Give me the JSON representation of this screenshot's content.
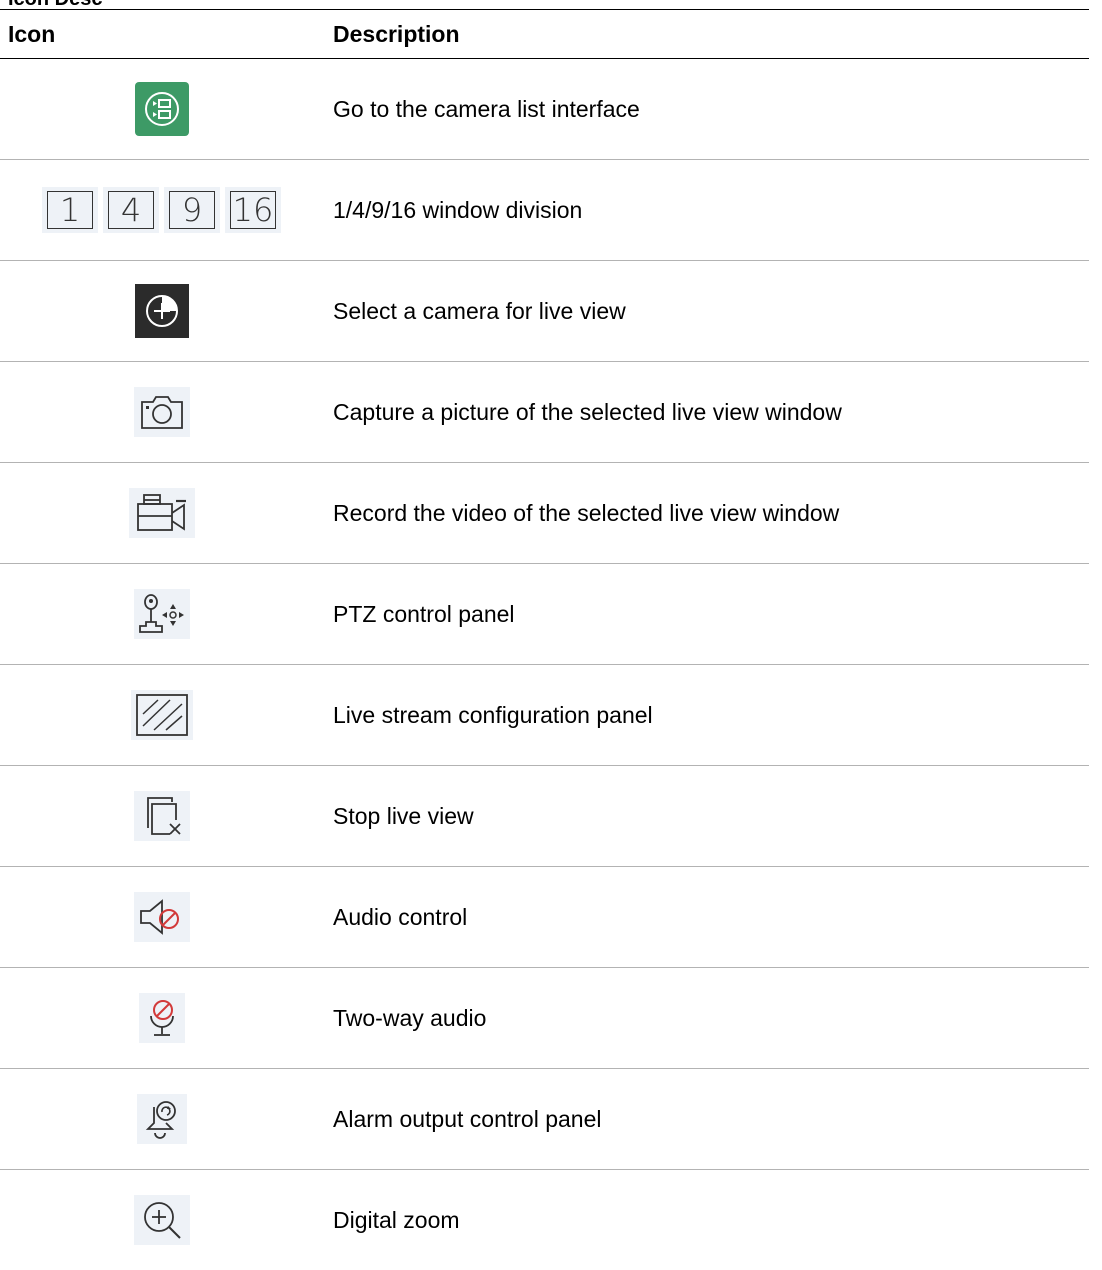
{
  "top_fragment": "Icon Desc",
  "headers": {
    "icon": "Icon",
    "description": "Description"
  },
  "division_labels": [
    "1",
    "4",
    "9",
    "16"
  ],
  "rows": [
    {
      "icon": "camera-list-icon",
      "description": "Go to the camera list interface"
    },
    {
      "icon": "window-division-icon",
      "description": "1/4/9/16 window division"
    },
    {
      "icon": "add-camera-icon",
      "description": "Select a camera for live view"
    },
    {
      "icon": "capture-icon",
      "description": "Capture a picture of the selected live view window"
    },
    {
      "icon": "record-icon",
      "description": "Record the video of the selected live view window"
    },
    {
      "icon": "ptz-icon",
      "description": "PTZ control panel"
    },
    {
      "icon": "stream-config-icon",
      "description": "Live stream configuration panel"
    },
    {
      "icon": "stop-live-view-icon",
      "description": "Stop live view"
    },
    {
      "icon": "audio-control-icon",
      "description": "Audio control"
    },
    {
      "icon": "two-way-audio-icon",
      "description": "Two-way audio"
    },
    {
      "icon": "alarm-output-icon",
      "description": "Alarm output control panel"
    },
    {
      "icon": "digital-zoom-icon",
      "description": "Digital zoom"
    }
  ],
  "colors": {
    "camera_list_bg": "#3d9a66",
    "add_camera_bg": "#2b2b2b",
    "icon_bg": "#eef2f7",
    "prohibit_red": "#d23a3a"
  }
}
